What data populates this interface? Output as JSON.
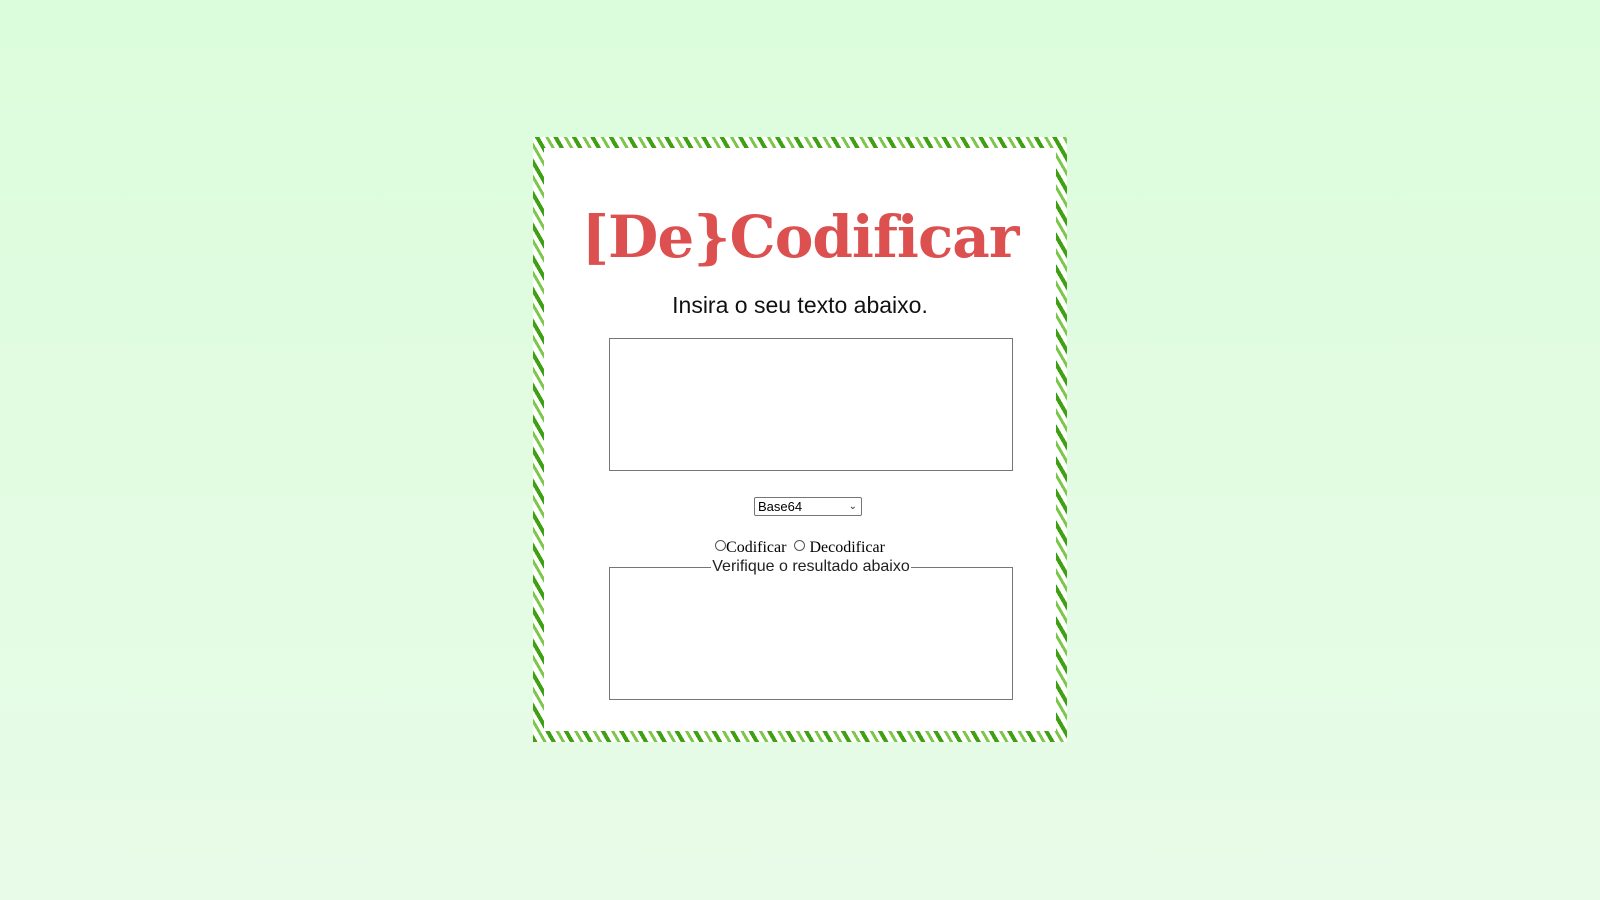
{
  "app": {
    "title": "[De}Codificar",
    "subtitle": "Insira o seu texto abaixo."
  },
  "input": {
    "value": "",
    "placeholder": ""
  },
  "method_select": {
    "selected": "Base64"
  },
  "mode": {
    "encode_label": "Codificar",
    "decode_label": "Decodificar"
  },
  "result": {
    "legend": "Verifique o resultado abaixo",
    "value": ""
  },
  "colors": {
    "background": "#dcfddc",
    "title": "#dc5050",
    "border_leaf_dark": "#3fa012",
    "border_leaf_light": "#7cc74a"
  },
  "icons": {
    "select_arrow": "chevron-down-icon"
  }
}
